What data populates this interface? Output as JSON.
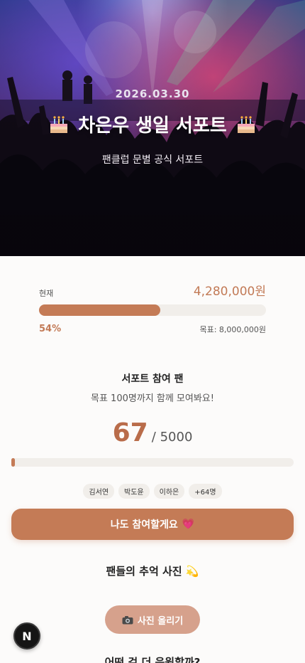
{
  "hero": {
    "date": "2026.03.30",
    "title": "차은우 생일 서포트",
    "subtitle": "팬클럽 문별 공식 서포트",
    "left_icon": "cake-icon",
    "right_icon": "cake-icon"
  },
  "funding": {
    "current_label": "현재",
    "amount": "4,280,000원",
    "percent_text": "54%",
    "progress": 0.535,
    "goal_text": "목표: 8,000,000원"
  },
  "participants": {
    "title": "서포트 참여 팬",
    "subtitle": "목표 100명까지 함께 모여봐요!",
    "count": "67",
    "total": "/ 5000",
    "progress": 0.0134,
    "chips": [
      "김서연",
      "박도윤",
      "이하은",
      "+64명"
    ]
  },
  "join_button": {
    "label": "나도 참여할게요",
    "icon": "heart-icon"
  },
  "photos": {
    "title": "팬들의 추억 사진 💫"
  },
  "upload_button": {
    "label": "사진 올리기",
    "icon": "camera-icon"
  },
  "next_section": {
    "title": "어떤 걸 더 응원할까?"
  },
  "badge": {
    "letter": "N"
  },
  "colors": {
    "accent": "#c47b56",
    "accent_light": "#d6a18c",
    "track": "#f1eeea"
  }
}
